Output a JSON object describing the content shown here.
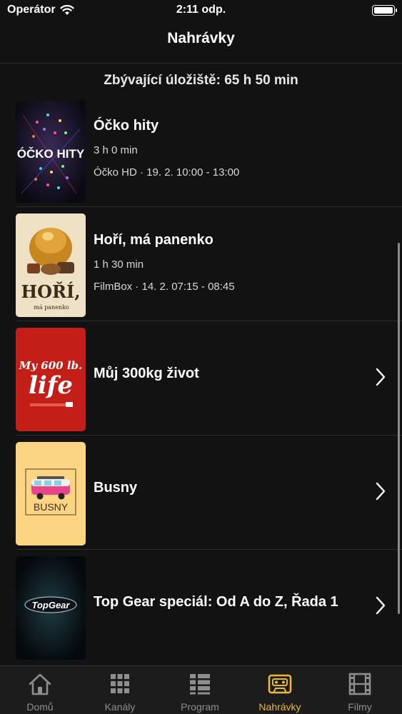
{
  "status_bar": {
    "carrier": "Operátor",
    "time": "2:11 odp."
  },
  "header": {
    "title": "Nahrávky"
  },
  "storage": {
    "text": "Zbývající úložiště: 65 h 50 min"
  },
  "recordings": [
    {
      "title": "Óčko hity",
      "duration": "3 h 0 min",
      "channel_info": "Óčko HD · 19. 2. 10:00 - 13:00",
      "poster_text": "ÓČKO HITY"
    },
    {
      "title": "Hoří, má panenko",
      "duration": "1 h 30 min",
      "channel_info": "FilmBox · 14. 2. 07:15 - 08:45",
      "poster_text": "HOŘÍ,",
      "poster_subtext": "má panenko"
    },
    {
      "title": "Můj 300kg život",
      "poster_text_1": "My 600 lb.",
      "poster_text_2": "life"
    },
    {
      "title": "Busny",
      "poster_text": "BUSNY"
    },
    {
      "title": "Top Gear speciál: Od A do Z, Řada 1",
      "poster_text": "TopGear"
    }
  ],
  "tabs": [
    {
      "label": "Domů",
      "icon": "home-icon"
    },
    {
      "label": "Kanály",
      "icon": "grid-icon"
    },
    {
      "label": "Program",
      "icon": "list-icon"
    },
    {
      "label": "Nahrávky",
      "icon": "cassette-icon"
    },
    {
      "label": "Filmy",
      "icon": "film-icon"
    }
  ],
  "colors": {
    "background": "#121212",
    "accent": "#e9b93a",
    "inactive_tab": "#8e8e8e"
  }
}
